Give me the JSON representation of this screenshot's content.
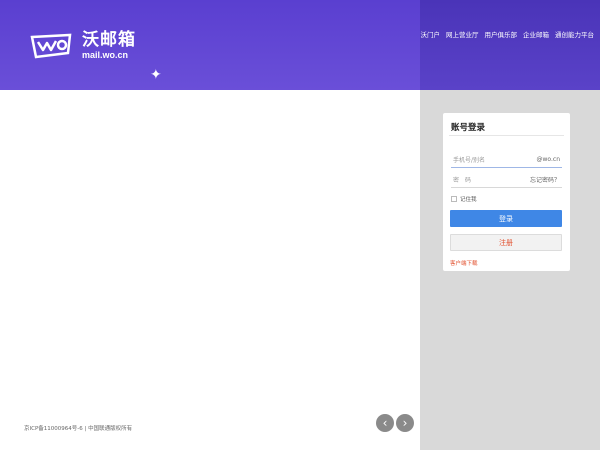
{
  "header": {
    "logo_cn": "沃邮箱",
    "logo_en": "mail.wo.cn",
    "nav": [
      "沃门户",
      "网上营业厅",
      "用户俱乐部",
      "企业邮箱",
      "通创能力平台"
    ]
  },
  "login": {
    "title": "账号登录",
    "username_placeholder": "手机号/别名",
    "username_suffix": "@wo.cn",
    "password_placeholder": "密　码",
    "forgot_password": "忘记密码？",
    "remember_me": "记住我",
    "login_button": "登录",
    "register_button": "注册",
    "client_download": "客户端下载"
  },
  "footer": {
    "icp": "京ICP备11000964号-6 | 中国联通版权所有"
  },
  "carousel": {
    "prev_icon": "chevron-left-icon",
    "next_icon": "chevron-right-icon"
  },
  "colors": {
    "header_bg": "#5a3fd0",
    "accent_blue": "#3f87e6",
    "register_text": "#e2512f",
    "side_bg": "#d9d9d9"
  }
}
